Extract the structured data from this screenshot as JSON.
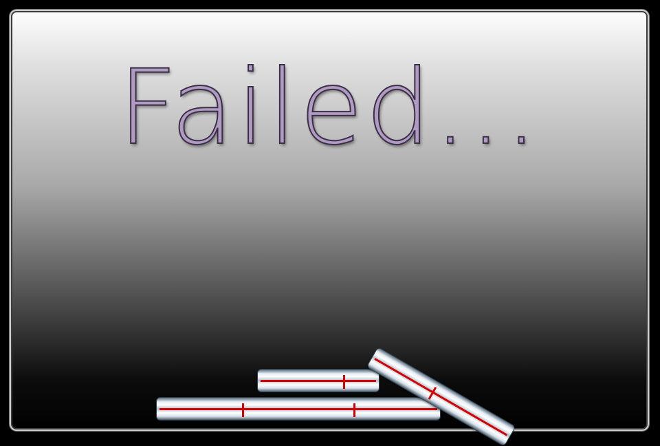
{
  "screen": {
    "title": "Failed...",
    "status": "failed"
  },
  "blocks": [
    {
      "name": "bottom-block",
      "ticks": [
        0.3,
        0.7
      ]
    },
    {
      "name": "middle-block",
      "ticks": [
        0.72
      ]
    },
    {
      "name": "tilted-block",
      "ticks": [
        0.45
      ]
    }
  ],
  "colors": {
    "title_fill": "#b09bc2",
    "title_outline": "#3b2f46",
    "block_line": "#d40000"
  }
}
